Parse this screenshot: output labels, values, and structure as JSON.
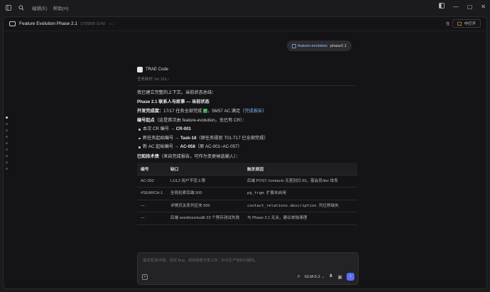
{
  "menu": {
    "edit": "编辑(E)",
    "help": "帮助(H)"
  },
  "header": {
    "title": "Feature Evolution Phase 2.1",
    "time": "17日09日 10:42",
    "dots": "⋯",
    "tag": "在",
    "open_label": "中打开"
  },
  "user_message": {
    "tag": "feature-evolution",
    "text": "phase2.1"
  },
  "assistant": {
    "name": "TRAE Code",
    "subtitle": "任务耗时 1m 12s ›",
    "intro": "我已建立完整的上下文。当前状态总结：",
    "heading": "Phase 2.1 联系人与故事 — 当前状态",
    "progress_label": "开发完成度：",
    "progress_text": "17/17 任务全部完成",
    "progress_ac": "，56/57 AC 满足（",
    "progress_link": "完成报告",
    "progress_end": "）",
    "numbering_label": "编号起点",
    "numbering_text": "（这是首次由 feature-evolution，无已有 CR）：",
    "bullets": [
      {
        "pre": "本次 CR 编号 → ",
        "val": "CR-001",
        "post": ""
      },
      {
        "pre": "新任务起始编号 → ",
        "val": "Task-18",
        "post": "（原任务规划 T01-T17 已全部完成）"
      },
      {
        "pre": "新 AC 起始编号 → ",
        "val": "AC-058",
        "post": "（原 AC-001~AC-057）"
      }
    ],
    "debt_label": "已知技术债",
    "debt_text": "（来自完成报告，可作为变更候选输入）：",
    "table": {
      "headers": [
        "编号",
        "缺口",
        "触发原因"
      ],
      "rows": [
        {
          "id": "AC-052",
          "gap": "L1/L2 用户不受上限",
          "cause": "后端 POST /contacts 无差别扫 50，需会员/tier 体系"
        },
        {
          "id": "#SEARCH-1",
          "gap": "全局检索后端 500",
          "cause": "pg_trgm 扩展未启用"
        },
        {
          "id": "—",
          "gap": "详情页关系列区块 500",
          "cause": "contact_relations.description 列迁移缺失"
        },
        {
          "id": "—",
          "gap": "后端 seed/oss/audit 23 个预存测试失败",
          "cause": "与 Phase 2.1 无关，建议单独清理"
        }
      ]
    }
  },
  "input": {
    "placeholder": "描述需求/问题、调试 Bug、或找我帮开发工作，针对生产物的问题吗。",
    "model": "GLM-5.2"
  },
  "icons": {
    "sidebar": "sidebar-toggle-icon",
    "search": "search-icon",
    "chat": "chat-icon",
    "send": "send-arrow-icon",
    "mic": "microphone-icon",
    "attach": "attach-icon"
  }
}
